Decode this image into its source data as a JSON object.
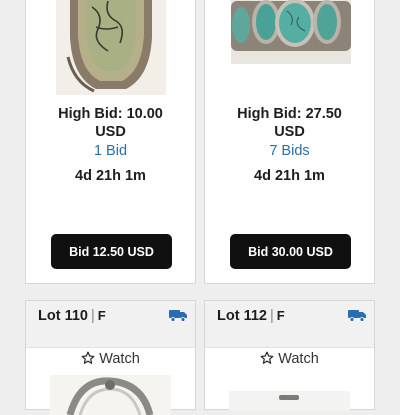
{
  "lots": [
    {
      "high_bid": "High Bid: 10.00\nUSD",
      "bid_count": "1 Bid",
      "time_left": "4d 21h 1m",
      "bid_button": "Bid 12.50 USD",
      "image": "green-turquoise-ring"
    },
    {
      "high_bid": "High Bid: 27.50\nUSD",
      "bid_count": "7 Bids",
      "time_left": "4d 21h 1m",
      "bid_button": "Bid 30.00 USD",
      "image": "turquoise-cuff-bracelet"
    },
    {
      "lot_label": "Lot 110",
      "lot_type": "F",
      "watch_label": "Watch",
      "image": "silver-bangle"
    },
    {
      "lot_label": "Lot 112",
      "lot_type": "F",
      "watch_label": "Watch",
      "image": "silver-jewelry"
    }
  ],
  "icons": {
    "shipping": "truck-icon",
    "watch": "star-outline-icon"
  },
  "colors": {
    "bid_count_link": "#2d6ea3",
    "shipping_icon": "#2b6cb0",
    "bid_button": "#101010"
  }
}
